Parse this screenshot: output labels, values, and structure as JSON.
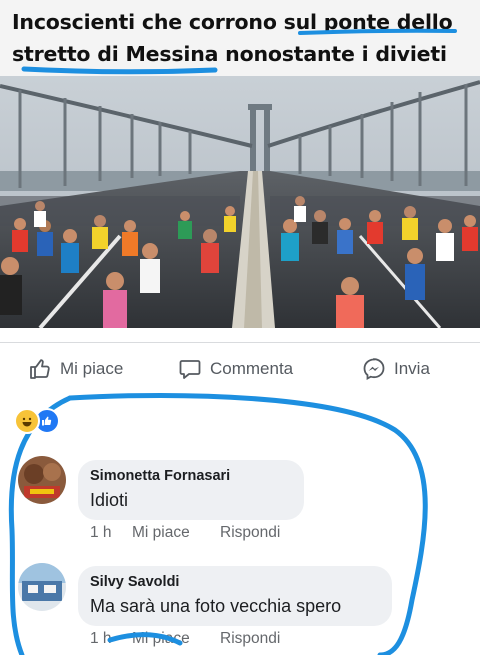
{
  "caption": {
    "line1": "Incoscienti che corrono sul ponte dello",
    "line2": "stretto di Messina nonostante i divieti"
  },
  "actions": {
    "like_label": "Mi piace",
    "comment_label": "Commenta",
    "send_label": "Invia"
  },
  "reactions": [
    "haha",
    "like"
  ],
  "comments": [
    {
      "name": "Simonetta Fornasari",
      "text": "Idioti",
      "time": "1 h",
      "like_label": "Mi piace",
      "reply_label": "Rispondi"
    },
    {
      "name": "Silvy Savoldi",
      "text": "Ma sarà una foto vecchia spero",
      "time": "1 h",
      "like_label": "Mi piace",
      "reply_label": "Rispondi"
    }
  ],
  "colors": {
    "annotation": "#1d8fe0",
    "like_blue": "#2078f4",
    "text_gray": "#65686c"
  }
}
